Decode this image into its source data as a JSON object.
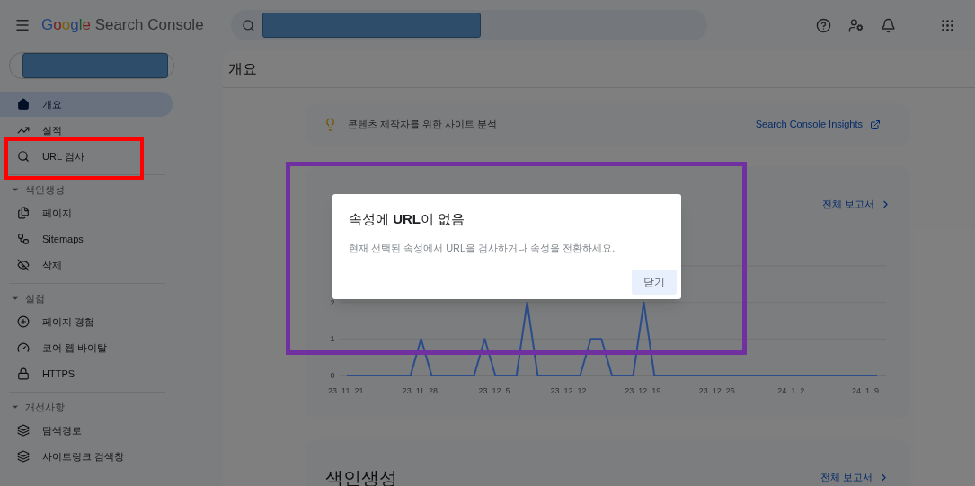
{
  "header": {
    "logo": {
      "brand": "Google",
      "product": "Search Console"
    }
  },
  "page_title": "개요",
  "sidebar": {
    "items": [
      {
        "label": "개요",
        "selected": true
      },
      {
        "label": "실적",
        "selected": false
      },
      {
        "label": "URL 검사",
        "selected": false
      }
    ],
    "sections": [
      {
        "title": "색인생성",
        "expanded": true,
        "items": [
          {
            "label": "페이지",
            "selected": false
          },
          {
            "label": "Sitemaps",
            "selected": false
          },
          {
            "label": "삭제",
            "selected": false
          }
        ]
      },
      {
        "title": "실험",
        "expanded": true,
        "items": [
          {
            "label": "페이지 경험",
            "selected": false
          },
          {
            "label": "코어 웹 바이탈",
            "selected": false
          },
          {
            "label": "HTTPS",
            "selected": false
          }
        ]
      },
      {
        "title": "개선사항",
        "expanded": true,
        "items": [
          {
            "label": "탐색경로",
            "selected": false
          },
          {
            "label": "사이트링크 검색창",
            "selected": false
          }
        ]
      }
    ]
  },
  "insights_card": {
    "text": "콘텐츠 제작자를 위한 사이트 분석",
    "link": "Search Console Insights"
  },
  "performance_card": {
    "link": "전체 보고서",
    "chart_data": {
      "type": "line",
      "categories": [
        "23. 11. 21.",
        null,
        null,
        null,
        null,
        null,
        null,
        "23. 11. 28.",
        null,
        null,
        null,
        null,
        null,
        null,
        "23. 12. 5.",
        null,
        null,
        null,
        null,
        null,
        null,
        "23. 12. 12.",
        null,
        null,
        null,
        null,
        null,
        null,
        "23. 12. 19.",
        null,
        null,
        null,
        null,
        null,
        null,
        "23. 12. 26.",
        null,
        null,
        null,
        null,
        null,
        null,
        "24. 1. 2.",
        null,
        null,
        null,
        null,
        null,
        null,
        "24. 1. 9.",
        null
      ],
      "series": [
        {
          "color": "#2b4c8c",
          "values": [
            0,
            0,
            0,
            0,
            0,
            0,
            0,
            1,
            0,
            0,
            0,
            0,
            0,
            1,
            0,
            0,
            0,
            2,
            0,
            0,
            0,
            0,
            0,
            1,
            1,
            0,
            0,
            0,
            2,
            0,
            0,
            0,
            0,
            0,
            0,
            0,
            0,
            0,
            0,
            0,
            0,
            0,
            0,
            0,
            0,
            0,
            0,
            0,
            0,
            0,
            0
          ]
        }
      ],
      "ylim": [
        0,
        3
      ],
      "yticks": [
        0,
        1,
        2
      ]
    }
  },
  "indexing_card": {
    "title": "색인생성",
    "link": "전체 보고서"
  },
  "dialog": {
    "title": "속성에 **URL**이 없음",
    "body": "현재 선택된 속성에서 URL을 검사하거나 속성을 전환하세요.",
    "button": "닫기"
  }
}
